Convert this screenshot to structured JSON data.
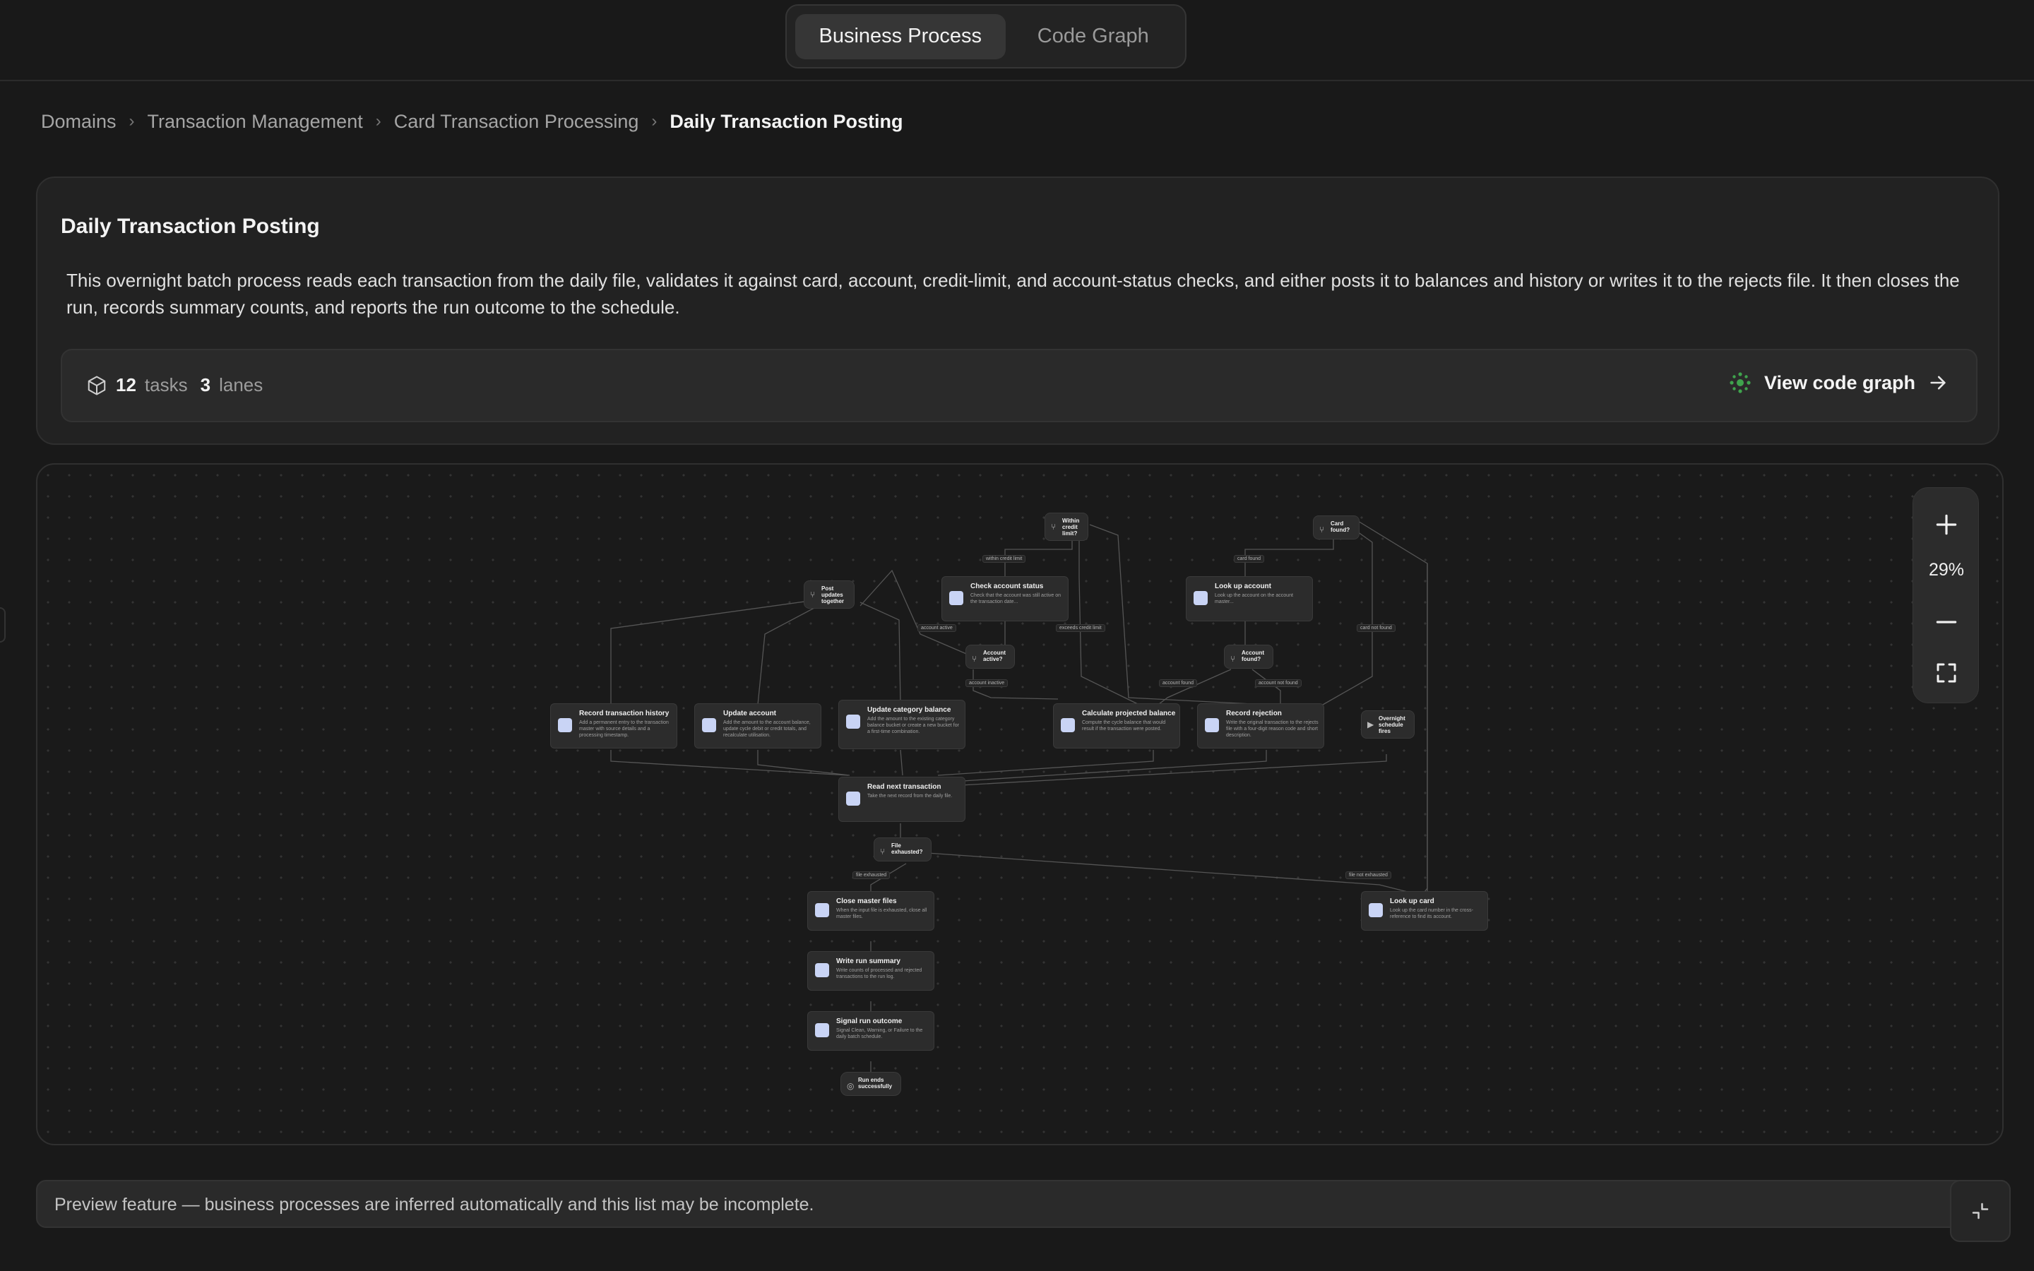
{
  "top_toggle": {
    "active": "Business Process",
    "inactive": "Code Graph"
  },
  "breadcrumb": [
    "Domains",
    "Transaction Management",
    "Card Transaction Processing",
    "Daily Transaction Posting"
  ],
  "card": {
    "title": "Daily Transaction Posting",
    "description": "This overnight batch process reads each transaction from the daily file, validates it against card, account, credit-limit, and account-status checks, and either posts it to balances and history or writes it to the rejects file. It then closes the run, records summary counts, and reports the run outcome to the schedule.",
    "tasks_count": "12",
    "tasks_label": "tasks",
    "lanes_count": "3",
    "lanes_label": "lanes",
    "view_code_graph": "View code graph",
    "accent": "#3fa34d"
  },
  "graph": {
    "tasks": {
      "record_history": {
        "title": "Record transaction history",
        "desc": "Add a permanent entry to the transaction master with source details and a processing timestamp."
      },
      "update_account": {
        "title": "Update account",
        "desc": "Add the amount to the account balance, update cycle debit or credit totals, and recalculate utilisation."
      },
      "update_category": {
        "title": "Update category balance",
        "desc": "Add the amount to the existing category balance bucket or create a new bucket for a first-time combination."
      },
      "check_status": {
        "title": "Check account status",
        "desc": "Check that the account was still active on the transaction date..."
      },
      "lookup_account": {
        "title": "Look up account",
        "desc": "Look up the account on the account master..."
      },
      "calc_projected": {
        "title": "Calculate projected balance",
        "desc": "Compute the cycle balance that would result if the transaction were posted."
      },
      "record_rejection": {
        "title": "Record rejection",
        "desc": "Write the original transaction to the rejects file with a four-digit reason code and short description."
      },
      "read_next": {
        "title": "Read next transaction",
        "desc": "Take the next record from the daily file."
      },
      "close_master": {
        "title": "Close master files",
        "desc": "When the input file is exhausted, close all master files."
      },
      "write_summary": {
        "title": "Write run summary",
        "desc": "Write counts of processed and rejected transactions to the run log."
      },
      "signal_outcome": {
        "title": "Signal run outcome",
        "desc": "Signal Clean, Warning, or Failure to the daily batch schedule."
      },
      "lookup_card": {
        "title": "Look up card",
        "desc": "Look up the card number in the cross-reference to find its account."
      }
    },
    "decisions": {
      "within_limit": "Within credit limit?",
      "card_found": "Card found?",
      "post_together": "Post updates together",
      "account_active": "Account active?",
      "account_found": "Account found?",
      "file_exhausted": "File exhausted?"
    },
    "events": {
      "overnight": "Overnight schedule fires",
      "run_ends": "Run ends successfully"
    },
    "edge_labels": {
      "within_limit": "within credit limit",
      "card_found": "card found",
      "account_active": "account active",
      "exceeds_limit": "exceeds credit limit",
      "card_not_found": "card not found",
      "account_inactive": "account inactive",
      "account_found": "account found",
      "account_not_found": "account not found",
      "file_exhausted": "file exhausted",
      "file_not_exhausted": "file not exhausted"
    }
  },
  "zoom": {
    "level": "29%"
  },
  "footer": {
    "notice": "Preview feature — business processes are inferred automatically and this list may be incomplete."
  }
}
